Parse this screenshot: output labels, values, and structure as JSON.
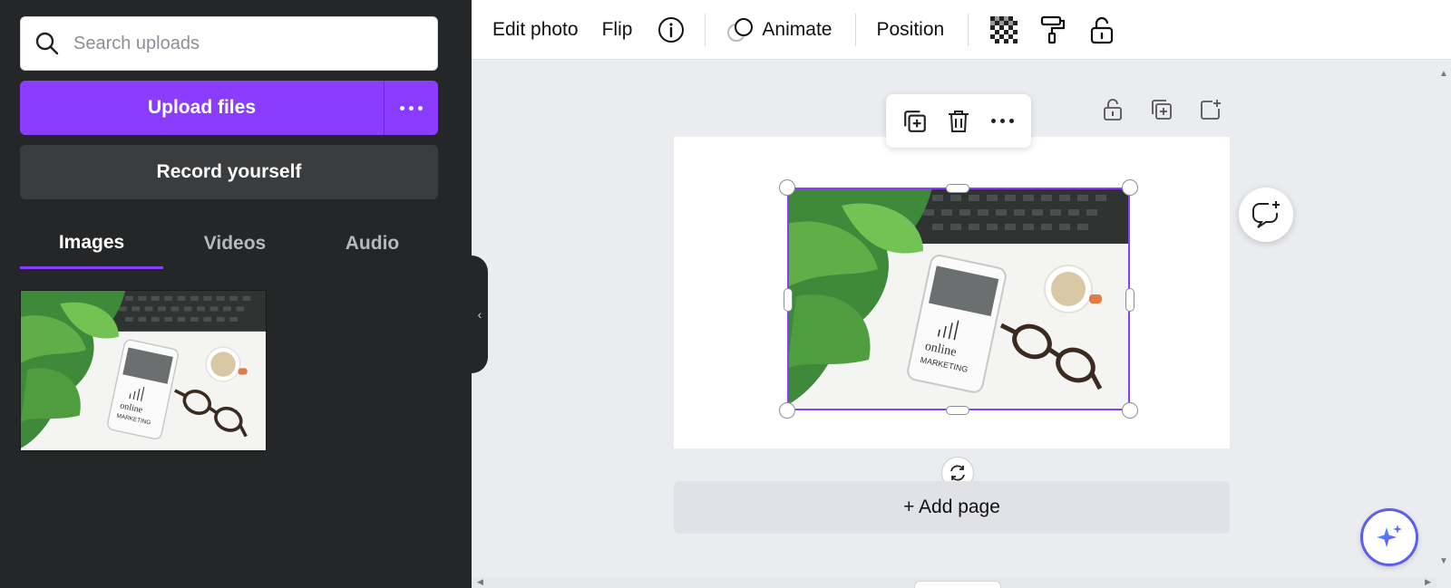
{
  "sidebar": {
    "search": {
      "placeholder": "Search uploads",
      "value": ""
    },
    "upload_label": "Upload files",
    "record_label": "Record yourself",
    "tabs": [
      {
        "label": "Images",
        "active": true
      },
      {
        "label": "Videos",
        "active": false
      },
      {
        "label": "Audio",
        "active": false
      }
    ],
    "collapse_icon": "chevron-left-icon"
  },
  "toolbar": {
    "edit_photo": "Edit photo",
    "flip": "Flip",
    "animate": "Animate",
    "position": "Position",
    "icons": [
      "info-icon",
      "animate-icon",
      "transparency-icon",
      "paint-roller-icon",
      "lock-icon"
    ]
  },
  "canvas": {
    "add_page": "+ Add page",
    "page_action_icons": [
      "unlock-icon",
      "duplicate-icon",
      "add-page-icon"
    ],
    "context_icons": [
      "duplicate-icon",
      "trash-icon",
      "more-icon"
    ]
  },
  "colors": {
    "accent": "#8b3dff",
    "sidebar_bg": "#252627",
    "canvas_bg": "#ebecf0"
  }
}
